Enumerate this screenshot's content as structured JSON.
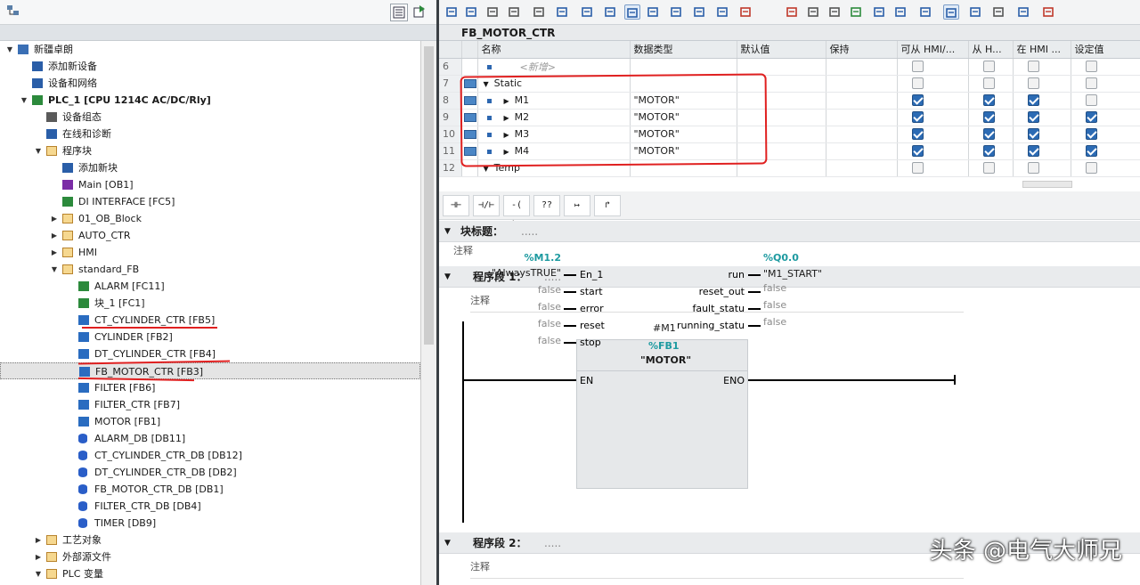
{
  "project_tree": {
    "items": [
      {
        "label": "新疆卓朗",
        "level": 0,
        "expander": "down",
        "icon": "project-icon",
        "color": "#3a6fb5"
      },
      {
        "label": "添加新设备",
        "level": 1,
        "expander": "",
        "icon": "add-device-icon",
        "color": "#2a5ea8"
      },
      {
        "label": "设备和网络",
        "level": 1,
        "expander": "",
        "icon": "network-icon",
        "color": "#2a5ea8"
      },
      {
        "label": "PLC_1 [CPU 1214C AC/DC/Rly]",
        "level": 1,
        "expander": "down",
        "icon": "plc-icon",
        "color": "#2c8a3c",
        "bold": true
      },
      {
        "label": "设备组态",
        "level": 2,
        "expander": "",
        "icon": "device-config-icon",
        "color": "#5a5a5a"
      },
      {
        "label": "在线和诊断",
        "level": 2,
        "expander": "",
        "icon": "diagnostics-icon",
        "color": "#2a5ea8"
      },
      {
        "label": "程序块",
        "level": 2,
        "expander": "down",
        "icon": "folder-icon",
        "color": "#b8832c"
      },
      {
        "label": "添加新块",
        "level": 3,
        "expander": "",
        "icon": "add-block-icon",
        "color": "#2a5ea8"
      },
      {
        "label": "Main [OB1]",
        "level": 3,
        "expander": "",
        "icon": "ob-icon",
        "color": "#7b2da6"
      },
      {
        "label": "DI INTERFACE [FC5]",
        "level": 3,
        "expander": "",
        "icon": "fc-icon",
        "color": "#2c8a3c"
      },
      {
        "label": "01_OB_Block",
        "level": 3,
        "expander": "right",
        "icon": "folder-icon",
        "color": "#b8832c"
      },
      {
        "label": "AUTO_CTR",
        "level": 3,
        "expander": "right",
        "icon": "folder-icon",
        "color": "#b8832c"
      },
      {
        "label": "HMI",
        "level": 3,
        "expander": "right",
        "icon": "folder-icon",
        "color": "#b8832c"
      },
      {
        "label": "standard_FB",
        "level": 3,
        "expander": "down",
        "icon": "folder-icon",
        "color": "#b8832c"
      },
      {
        "label": "ALARM [FC11]",
        "level": 4,
        "expander": "",
        "icon": "fc-icon",
        "color": "#2c8a3c"
      },
      {
        "label": "块_1 [FC1]",
        "level": 4,
        "expander": "",
        "icon": "fc-icon",
        "color": "#2c8a3c"
      },
      {
        "label": "CT_CYLINDER_CTR [FB5]",
        "level": 4,
        "expander": "",
        "icon": "fb-icon",
        "color": "#2a6cc0"
      },
      {
        "label": "CYLINDER [FB2]",
        "level": 4,
        "expander": "",
        "icon": "fb-icon",
        "color": "#2a6cc0"
      },
      {
        "label": "DT_CYLINDER_CTR [FB4]",
        "level": 4,
        "expander": "",
        "icon": "fb-icon",
        "color": "#2a6cc0"
      },
      {
        "label": "FB_MOTOR_CTR [FB3]",
        "level": 4,
        "expander": "",
        "icon": "fb-icon",
        "color": "#2a6cc0",
        "selected": true
      },
      {
        "label": "FILTER [FB6]",
        "level": 4,
        "expander": "",
        "icon": "fb-icon",
        "color": "#2a6cc0"
      },
      {
        "label": "FILTER_CTR [FB7]",
        "level": 4,
        "expander": "",
        "icon": "fb-icon",
        "color": "#2a6cc0"
      },
      {
        "label": "MOTOR [FB1]",
        "level": 4,
        "expander": "",
        "icon": "fb-icon",
        "color": "#2a6cc0"
      },
      {
        "label": "ALARM_DB [DB11]",
        "level": 4,
        "expander": "",
        "icon": "db-icon",
        "color": "#2a5ec8"
      },
      {
        "label": "CT_CYLINDER_CTR_DB [DB12]",
        "level": 4,
        "expander": "",
        "icon": "db-icon",
        "color": "#2a5ec8"
      },
      {
        "label": "DT_CYLINDER_CTR_DB [DB2]",
        "level": 4,
        "expander": "",
        "icon": "db-icon",
        "color": "#2a5ec8"
      },
      {
        "label": "FB_MOTOR_CTR_DB [DB1]",
        "level": 4,
        "expander": "",
        "icon": "db-icon",
        "color": "#2a5ec8"
      },
      {
        "label": "FILTER_CTR_DB [DB4]",
        "level": 4,
        "expander": "",
        "icon": "db-icon",
        "color": "#2a5ec8"
      },
      {
        "label": "TIMER [DB9]",
        "level": 4,
        "expander": "",
        "icon": "db-icon",
        "color": "#2a5ec8"
      },
      {
        "label": "工艺对象",
        "level": 2,
        "expander": "right",
        "icon": "folder-icon",
        "color": "#b8832c"
      },
      {
        "label": "外部源文件",
        "level": 2,
        "expander": "right",
        "icon": "folder-icon",
        "color": "#b8832c"
      },
      {
        "label": "PLC 变量",
        "level": 2,
        "expander": "down",
        "icon": "folder-icon",
        "color": "#b8832c"
      }
    ]
  },
  "editor": {
    "block_title": "FB_MOTOR_CTR",
    "columns": [
      "名称",
      "数据类型",
      "默认值",
      "保持",
      "可从 HMI/...",
      "从 H...",
      "在 HMI ...",
      "设定值"
    ],
    "rows": [
      {
        "num": "6",
        "indent": 2,
        "expander": "",
        "name": "<新增>",
        "type": "",
        "default": "",
        "checks": [
          false,
          false,
          false,
          false
        ],
        "placeholder": true
      },
      {
        "num": "7",
        "indent": 1,
        "expander": "down",
        "name": "Static",
        "type": "",
        "default": "",
        "checks": [
          false,
          false,
          false,
          false
        ],
        "icon": true
      },
      {
        "num": "8",
        "indent": 2,
        "expander": "right",
        "name": "M1",
        "type": "\"MOTOR\"",
        "default": "",
        "checks": [
          true,
          true,
          true,
          false
        ],
        "icon": true
      },
      {
        "num": "9",
        "indent": 2,
        "expander": "right",
        "name": "M2",
        "type": "\"MOTOR\"",
        "default": "",
        "checks": [
          true,
          true,
          true,
          true
        ],
        "icon": true
      },
      {
        "num": "10",
        "indent": 2,
        "expander": "right",
        "name": "M3",
        "type": "\"MOTOR\"",
        "default": "",
        "checks": [
          true,
          true,
          true,
          true
        ],
        "icon": true
      },
      {
        "num": "11",
        "indent": 2,
        "expander": "right",
        "name": "M4",
        "type": "\"MOTOR\"",
        "default": "",
        "checks": [
          true,
          true,
          true,
          true
        ],
        "icon": true
      },
      {
        "num": "12",
        "indent": 1,
        "expander": "down",
        "name": "Temp",
        "type": "",
        "default": "",
        "checks": [
          false,
          false,
          false,
          false
        ],
        "icon": false
      }
    ],
    "ladder_buttons": [
      "⊣⊢",
      "⊣/⊢",
      "-( )-",
      "??",
      "↦",
      "↱"
    ],
    "block_title_label": "块标题：",
    "block_title_dots": ".....",
    "block_comment": "注释",
    "network1": {
      "title": "程序段 1：",
      "dots": ".....",
      "comment": "注释"
    },
    "network2": {
      "title": "程序段 2：",
      "dots": ".....",
      "comment": "注释"
    },
    "fb_call": {
      "instance": "#M1",
      "fb_addr": "%FB1",
      "fb_name": "\"MOTOR\"",
      "en": "EN",
      "eno": "ENO",
      "inputs": [
        {
          "pin": "En_1",
          "addr": "%M1.2",
          "value": "\"AlwaysTRUE\""
        },
        {
          "pin": "start",
          "value": "false"
        },
        {
          "pin": "error",
          "value": "false"
        },
        {
          "pin": "reset",
          "value": "false"
        },
        {
          "pin": "stop",
          "value": "false"
        }
      ],
      "outputs": [
        {
          "pin": "run",
          "addr": "%Q0.0",
          "value": "\"M1_START\""
        },
        {
          "pin": "reset_out",
          "value": "false"
        },
        {
          "pin": "fault_statu",
          "value": "false"
        },
        {
          "pin": "running_statu",
          "value": "false"
        }
      ]
    }
  },
  "watermark": "头条 @电气大师兄"
}
